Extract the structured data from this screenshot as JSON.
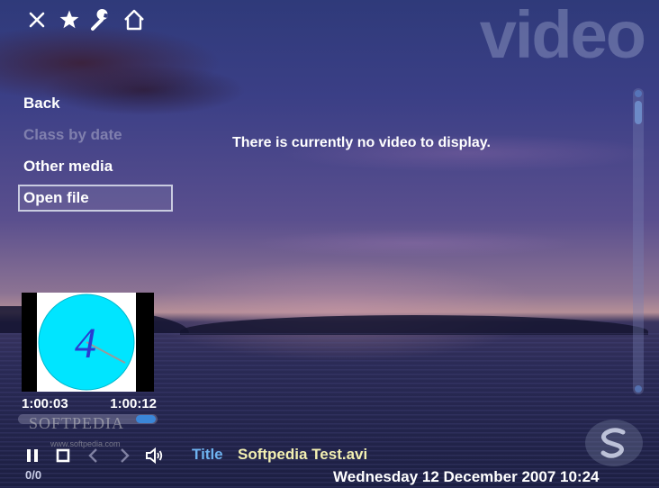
{
  "section": {
    "title": "video"
  },
  "top_icons": [
    "close-icon",
    "star-icon",
    "wrench-icon",
    "home-icon"
  ],
  "menu": {
    "items": [
      {
        "label": "Back",
        "state": "normal"
      },
      {
        "label": "Class by date",
        "state": "disabled"
      },
      {
        "label": "Other media",
        "state": "normal"
      },
      {
        "label": "Open file",
        "state": "selected"
      }
    ]
  },
  "message": "There is currently no video to display.",
  "preview": {
    "digit": "4",
    "dial_color": "#00e5ff",
    "digit_color": "#2a3bd1"
  },
  "playback": {
    "elapsed": "1:00:03",
    "total": "1:00:12",
    "progress": 0.99,
    "counter": "0/0"
  },
  "watermark": {
    "text": "SOFTPEDIA",
    "url": "www.softpedia.com"
  },
  "controls": [
    "pause-icon",
    "stop-icon",
    "previous-icon",
    "next-icon",
    "volume-icon"
  ],
  "now_playing": {
    "label": "Title",
    "value": "Softpedia Test.avi"
  },
  "status": {
    "datetime": "Wednesday 12 December 2007  10:24"
  },
  "colors": {
    "title_label": "#6eb2ef",
    "title_value": "#f3f0b2",
    "accent": "#3b86d8"
  }
}
